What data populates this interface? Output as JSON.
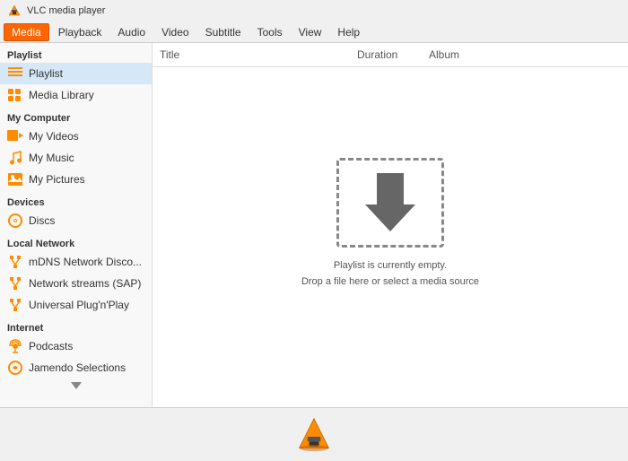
{
  "titleBar": {
    "appName": "VLC media player"
  },
  "menuBar": {
    "items": [
      {
        "label": "Media",
        "active": true
      },
      {
        "label": "Playback",
        "active": false
      },
      {
        "label": "Audio",
        "active": false
      },
      {
        "label": "Video",
        "active": false
      },
      {
        "label": "Subtitle",
        "active": false
      },
      {
        "label": "Tools",
        "active": false
      },
      {
        "label": "View",
        "active": false
      },
      {
        "label": "Help",
        "active": false
      }
    ]
  },
  "sidebar": {
    "sections": [
      {
        "header": "Playlist",
        "items": [
          {
            "label": "Playlist",
            "icon": "playlist",
            "selected": true
          },
          {
            "label": "Media Library",
            "icon": "media-library",
            "selected": false
          }
        ]
      },
      {
        "header": "My Computer",
        "items": [
          {
            "label": "My Videos",
            "icon": "video",
            "selected": false
          },
          {
            "label": "My Music",
            "icon": "music",
            "selected": false
          },
          {
            "label": "My Pictures",
            "icon": "pictures",
            "selected": false
          }
        ]
      },
      {
        "header": "Devices",
        "items": [
          {
            "label": "Discs",
            "icon": "disc",
            "selected": false
          }
        ]
      },
      {
        "header": "Local Network",
        "items": [
          {
            "label": "mDNS Network Disco...",
            "icon": "network",
            "selected": false
          },
          {
            "label": "Network streams (SAP)",
            "icon": "network",
            "selected": false
          },
          {
            "label": "Universal Plug'n'Play",
            "icon": "network",
            "selected": false
          }
        ]
      },
      {
        "header": "Internet",
        "items": [
          {
            "label": "Podcasts",
            "icon": "podcast",
            "selected": false
          },
          {
            "label": "Jamendo Selections",
            "icon": "jamendo",
            "selected": false
          }
        ]
      }
    ]
  },
  "contentHeader": {
    "titleCol": "Title",
    "durationCol": "Duration",
    "albumCol": "Album"
  },
  "emptyState": {
    "line1": "Playlist is currently empty.",
    "line2": "Drop a file here or select a media source"
  }
}
